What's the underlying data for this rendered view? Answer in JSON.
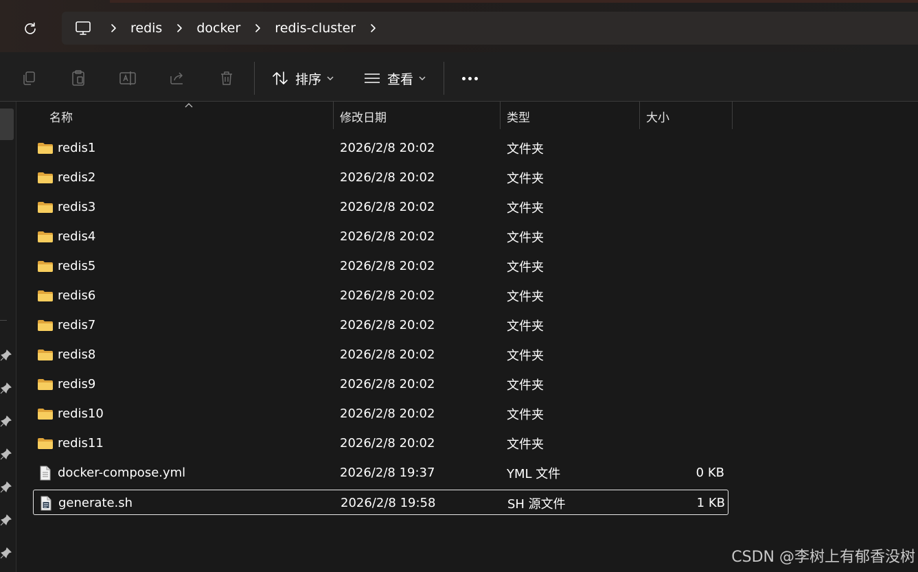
{
  "address_bar": {
    "path": [
      "redis",
      "docker",
      "redis-cluster"
    ]
  },
  "toolbar": {
    "sort_label": "排序",
    "view_label": "查看"
  },
  "columns": {
    "name": "名称",
    "date": "修改日期",
    "type": "类型",
    "size": "大小"
  },
  "files": [
    {
      "name": "redis1",
      "date": "2026/2/8 20:02",
      "type": "文件夹",
      "size": "",
      "icon": "folder-icon"
    },
    {
      "name": "redis2",
      "date": "2026/2/8 20:02",
      "type": "文件夹",
      "size": "",
      "icon": "folder-icon"
    },
    {
      "name": "redis3",
      "date": "2026/2/8 20:02",
      "type": "文件夹",
      "size": "",
      "icon": "folder-icon"
    },
    {
      "name": "redis4",
      "date": "2026/2/8 20:02",
      "type": "文件夹",
      "size": "",
      "icon": "folder-icon"
    },
    {
      "name": "redis5",
      "date": "2026/2/8 20:02",
      "type": "文件夹",
      "size": "",
      "icon": "folder-icon"
    },
    {
      "name": "redis6",
      "date": "2026/2/8 20:02",
      "type": "文件夹",
      "size": "",
      "icon": "folder-icon"
    },
    {
      "name": "redis7",
      "date": "2026/2/8 20:02",
      "type": "文件夹",
      "size": "",
      "icon": "folder-icon"
    },
    {
      "name": "redis8",
      "date": "2026/2/8 20:02",
      "type": "文件夹",
      "size": "",
      "icon": "folder-icon"
    },
    {
      "name": "redis9",
      "date": "2026/2/8 20:02",
      "type": "文件夹",
      "size": "",
      "icon": "folder-icon"
    },
    {
      "name": "redis10",
      "date": "2026/2/8 20:02",
      "type": "文件夹",
      "size": "",
      "icon": "folder-icon"
    },
    {
      "name": "redis11",
      "date": "2026/2/8 20:02",
      "type": "文件夹",
      "size": "",
      "icon": "folder-icon"
    },
    {
      "name": "docker-compose.yml",
      "date": "2026/2/8 19:37",
      "type": "YML 文件",
      "size": "0 KB",
      "icon": "text-file-icon"
    },
    {
      "name": "generate.sh",
      "date": "2026/2/8 19:58",
      "type": "SH 源文件",
      "size": "1 KB",
      "icon": "script-file-icon",
      "selected": true
    }
  ],
  "watermark": "CSDN @李树上有郁香没树",
  "colors": {
    "folder": "#f5c451",
    "background": "#191919",
    "address_bg": "#2d2a29"
  }
}
